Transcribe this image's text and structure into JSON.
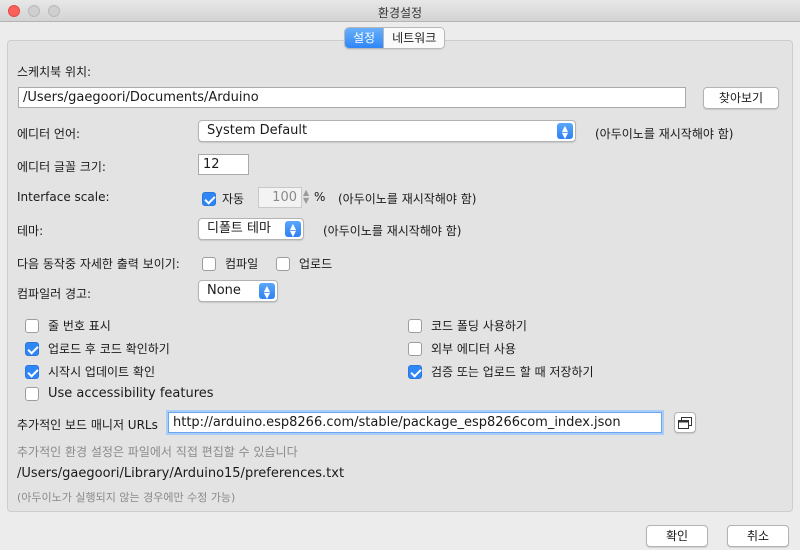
{
  "window": {
    "title": "환경설정"
  },
  "tabs": [
    {
      "label": "설정",
      "active": true
    },
    {
      "label": "네트워크",
      "active": false
    }
  ],
  "sketchbook": {
    "label": "스케치북 위치:",
    "path": "/Users/gaegoori/Documents/Arduino",
    "browse_label": "찾아보기"
  },
  "editor_language": {
    "label": "에디터 언어:",
    "value": "System Default",
    "note": "(아두이노를 재시작해야 함)"
  },
  "font_size": {
    "label": "에디터 글꼴 크기:",
    "value": "12"
  },
  "interface_scale": {
    "label": "Interface scale:",
    "auto_label": "자동",
    "auto_checked": true,
    "value": "100",
    "unit": "%",
    "note": "(아두이노를 재시작해야 함)"
  },
  "theme": {
    "label": "테마:",
    "value": "디폴트 테마",
    "note": "(아두이노를 재시작해야 함)"
  },
  "verbose": {
    "label": "다음 동작중 자세한  출력 보이기:",
    "compile_label": "컴파일",
    "compile_checked": false,
    "upload_label": "업로드",
    "upload_checked": false
  },
  "compiler_warnings": {
    "label": "컴파일러 경고:",
    "value": "None"
  },
  "options_left": [
    {
      "label": "줄 번호 표시",
      "checked": false
    },
    {
      "label": "업로드 후 코드 확인하기",
      "checked": true
    },
    {
      "label": "시작시 업데이트 확인",
      "checked": true
    },
    {
      "label": "Use accessibility features",
      "checked": false
    }
  ],
  "options_right": [
    {
      "label": "코드 폴딩 사용하기",
      "checked": false
    },
    {
      "label": "외부 에디터 사용",
      "checked": false
    },
    {
      "label": "검증 또는 업로드 할 때 저장하기",
      "checked": true
    }
  ],
  "board_urls": {
    "label": "추가적인 보드 매니저 URLs",
    "value": "http://arduino.esp8266.com/stable/package_esp8266com_index.json"
  },
  "more_prefs": {
    "hint": "추가적인 환경 설정은 파일에서 직접 편집할 수 있습니다",
    "path": "/Users/gaegoori/Library/Arduino15/preferences.txt",
    "note": "(아두이노가 실행되지 않는 경우에만 수정 가능)"
  },
  "footer": {
    "ok_label": "확인",
    "cancel_label": "취소"
  }
}
